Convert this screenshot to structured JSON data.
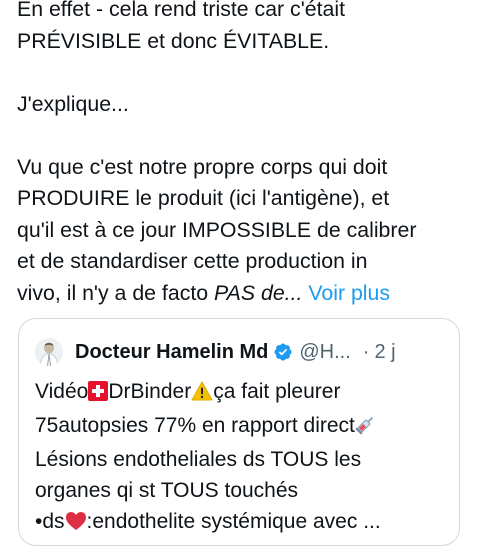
{
  "post": {
    "line1": "En effet - cela rend triste car c'était",
    "line2": "PRÉVISIBLE et donc ÉVITABLE.",
    "line3": "J'explique...",
    "line4": "Vu que c'est notre propre corps qui doit",
    "line5": "PRODUIRE le produit (ici l'antigène), et",
    "line6": "qu'il est à ce jour IMPOSSIBLE de calibrer",
    "line7": "et de standardiser cette production in",
    "line8_start": "vivo, il n'y a de facto ",
    "line8_em": "PAS de...",
    "show_more": "Voir plus"
  },
  "quote": {
    "author_name": "Docteur Hamelin Md",
    "handle": "@H...",
    "separator": "·",
    "time": "2 j",
    "q1a": "Vidéo",
    "q1b": "DrBinder",
    "q1c": "ça fait pleurer",
    "q2a": "75autopsies 77% en rapport direct",
    "q3": "Lésions endotheliales ds TOUS les",
    "q4": "organes qi st TOUS touchés",
    "q5a": "•ds",
    "q5b": ":endothelite systémique avec ..."
  },
  "icons": {
    "verified": "verified-badge-icon",
    "swiss_flag": "swiss-flag-emoji",
    "warning": "warning-emoji",
    "syringe": "syringe-emoji",
    "heart": "red-heart-emoji"
  },
  "colors": {
    "text": "#0f1419",
    "secondary": "#536471",
    "link": "#1d9bf0",
    "border": "#cfd9de"
  }
}
